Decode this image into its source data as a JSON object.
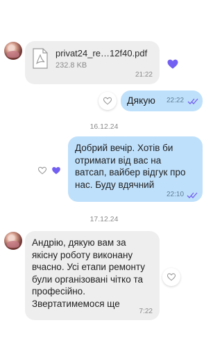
{
  "chat": {
    "msg1": {
      "file_name": "privat24_re…12f40.pdf",
      "file_size": "232.8 KB",
      "time": "21:22",
      "icon": "pdf-file-icon",
      "reaction": "heart-filled"
    },
    "msg2": {
      "text": "Дякую",
      "time": "22:22",
      "status": "read"
    },
    "date1": "16.12.24",
    "msg3": {
      "lines": [
        "Добрий вечір. Хотів би",
        "отримати від вас на",
        "ватсап, вайбер відгук про",
        "нас. Буду вдячний"
      ],
      "time": "22:10",
      "status": "read"
    },
    "date2": "17.12.24",
    "msg4": {
      "lines": [
        "Андрію, дякую вам за",
        "якісну роботу виконану",
        "вчасно. Усі етапи ремонту",
        "були організовані чітко та",
        "професійно.",
        "Звертатимемося ще"
      ],
      "time": "7:22"
    }
  },
  "colors": {
    "incoming_bubble": "#eeeeee",
    "outgoing_bubble": "#bfe0fb",
    "accent_purple": "#7360f2",
    "read_ticks": "#7360f2"
  }
}
